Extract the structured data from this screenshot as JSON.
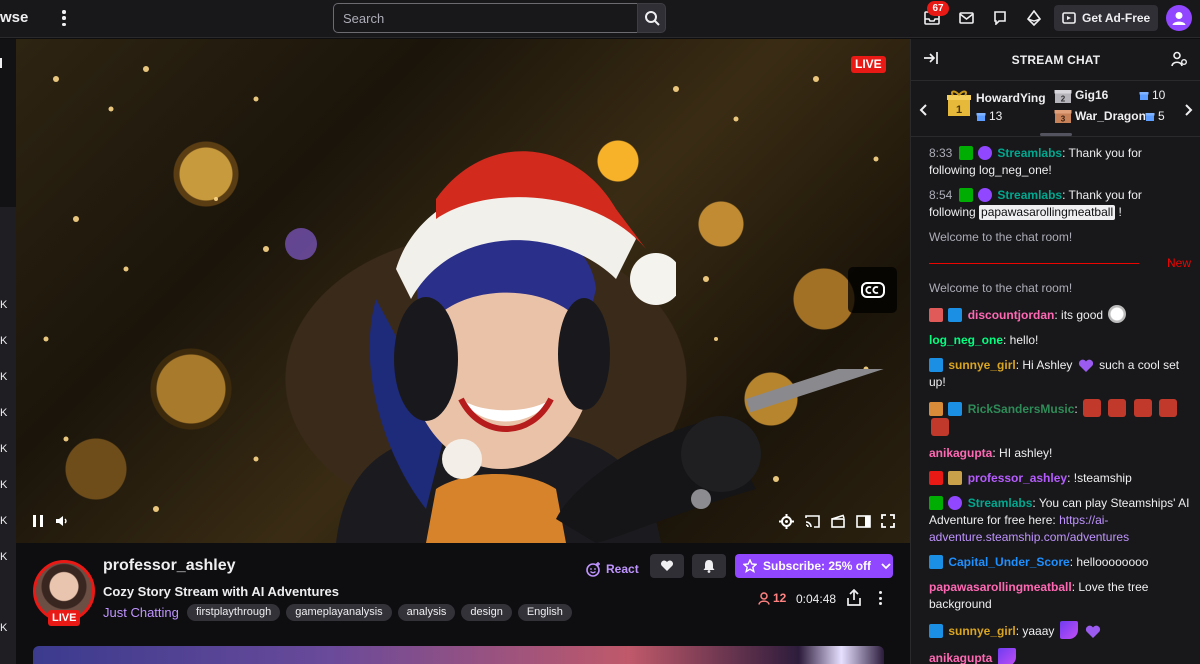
{
  "topbar": {
    "brand_text": "wse",
    "search_placeholder": "Search",
    "notification_count": "67",
    "get_ad_free_label": "Get Ad-Free"
  },
  "left_rail": {
    "counts": [
      "K",
      "K",
      "K",
      "K",
      "K",
      "K",
      "K",
      "K",
      "K"
    ]
  },
  "video": {
    "live_label": "LIVE"
  },
  "channel": {
    "name": "professor_ashley",
    "stream_title": "Cozy Story Stream with AI Adventures",
    "category": "Just Chatting",
    "live_label": "LIVE",
    "tags": [
      "firstplaythrough",
      "gameplayanalysis",
      "analysis",
      "design",
      "English"
    ],
    "react_label": "React",
    "subscribe_label": "Subscribe: 25% off",
    "viewer_count": "12",
    "uptime": "0:04:48"
  },
  "chat": {
    "title": "STREAM CHAT",
    "leaderboard": [
      {
        "name": "HowardYing",
        "count": "13",
        "rank": "1"
      },
      {
        "name": "Gig16",
        "count": "10",
        "rank": "2"
      },
      {
        "name": "War_Dragon",
        "count": "5",
        "rank": "3"
      }
    ],
    "new_label": "New",
    "messages": [
      {
        "time": "8:33",
        "user": "Streamlabs",
        "text": ": Thank you for following log_neg_one!"
      },
      {
        "time": "8:54",
        "user": "Streamlabs",
        "text_before": ": Thank you for following ",
        "mention": "papawasarollingmeatball",
        "text_after": " !"
      },
      {
        "system": "Welcome to the chat room!"
      },
      {
        "system": "Welcome to the chat room!"
      },
      {
        "user": "discountjordan",
        "text": ": its good"
      },
      {
        "user": "log_neg_one",
        "text": ": hello!"
      },
      {
        "user": "sunnye_girl",
        "text_before": ": Hi Ashley ",
        "text_after": " such a cool set up!"
      },
      {
        "user": "RickSandersMusic",
        "text": ":"
      },
      {
        "user": "anikagupta",
        "text": ": HI ashley!"
      },
      {
        "user": "professor_ashley",
        "text": ": !steamship"
      },
      {
        "user": "Streamlabs",
        "text": ": You can play Steamships' AI Adventure for free here: ",
        "link": "https://ai-adventure.steamship.com/adventures"
      },
      {
        "user": "Capital_Under_Score",
        "text": ": helloooooooo"
      },
      {
        "user": "papawasarollingmeatball",
        "text": ": Love the tree background"
      },
      {
        "user": "sunnye_girl",
        "text": ": yaaay"
      },
      {
        "user": "anikagupta",
        "text": ""
      }
    ]
  },
  "colors": {
    "accent": "#9147ff",
    "live_red": "#e91916",
    "streamlabs": "#00a88f",
    "discountjordan": "#ff69b4",
    "log_neg_one": "#00ff7f",
    "sunnye_girl": "#daa520",
    "ricksanders": "#2e8b57",
    "anikagupta": "#ff69b4",
    "professor_ashley": "#b65cff",
    "capital": "#1e90ff",
    "papawas": "#ff69b4"
  }
}
